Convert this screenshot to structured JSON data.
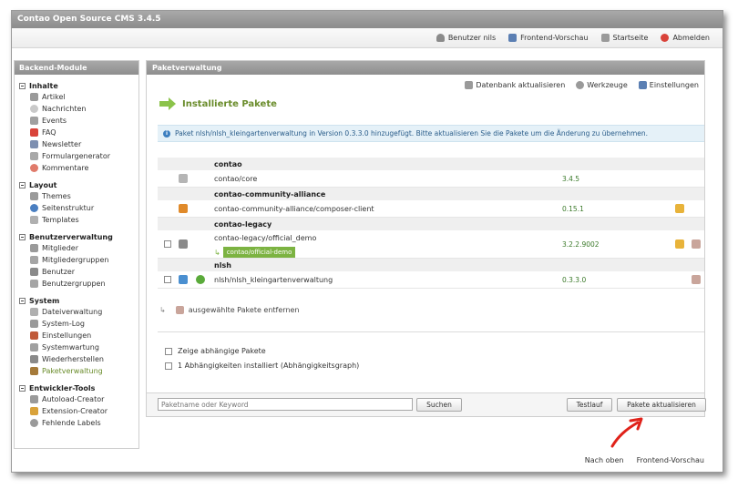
{
  "window": {
    "title": "Contao Open Source CMS 3.4.5"
  },
  "header": {
    "links": [
      {
        "label": "Benutzer nils",
        "icon": "user-icon"
      },
      {
        "label": "Frontend-Vorschau",
        "icon": "monitor-icon"
      },
      {
        "label": "Startseite",
        "icon": "home-icon"
      },
      {
        "label": "Abmelden",
        "icon": "logout-icon"
      }
    ]
  },
  "sidebar": {
    "title": "Backend-Module",
    "groups": [
      {
        "title": "Inhalte",
        "items": [
          "Artikel",
          "Nachrichten",
          "Events",
          "FAQ",
          "Newsletter",
          "Formulargenerator",
          "Kommentare"
        ]
      },
      {
        "title": "Layout",
        "items": [
          "Themes",
          "Seitenstruktur",
          "Templates"
        ]
      },
      {
        "title": "Benutzerverwaltung",
        "items": [
          "Mitglieder",
          "Mitgliedergruppen",
          "Benutzer",
          "Benutzergruppen"
        ]
      },
      {
        "title": "System",
        "items": [
          "Dateiverwaltung",
          "System-Log",
          "Einstellungen",
          "Systemwartung",
          "Wiederherstellen",
          "Paketverwaltung"
        ]
      },
      {
        "title": "Entwickler-Tools",
        "items": [
          "Autoload-Creator",
          "Extension-Creator",
          "Fehlende Labels"
        ]
      }
    ]
  },
  "main": {
    "title": "Paketverwaltung",
    "toolbar": [
      "Datenbank aktualisieren",
      "Werkzeuge",
      "Einstellungen"
    ],
    "section_title": "Installierte Pakete",
    "info": "Paket nlsh/nlsh_kleingartenverwaltung in Version 0.3.3.0 hinzugefügt. Bitte aktualisieren Sie die Pakete um die Änderung zu übernehmen.",
    "vendors": [
      {
        "name": "contao",
        "packages": [
          {
            "name": "contao/core",
            "version": "3.4.5"
          }
        ]
      },
      {
        "name": "contao-community-alliance",
        "packages": [
          {
            "name": "contao-community-alliance/composer-client",
            "version": "0.15.1"
          }
        ]
      },
      {
        "name": "contao-legacy",
        "packages": [
          {
            "name": "contao-legacy/official_demo",
            "version": "3.2.2.9002",
            "replaces": "contao/official-demo"
          }
        ]
      },
      {
        "name": "nlsh",
        "packages": [
          {
            "name": "nlsh/nlsh_kleingartenverwaltung",
            "version": "0.3.3.0"
          }
        ]
      }
    ],
    "remove_label": "ausgewählte Pakete entfernen",
    "options": [
      "Zeige abhängige Pakete",
      "1 Abhängigkeiten installiert (Abhängigkeitsgraph)"
    ],
    "search_placeholder": "Paketname oder Keyword",
    "search_button": "Suchen",
    "test_button": "Testlauf",
    "update_button": "Pakete aktualisieren"
  },
  "bottom_links": [
    "Nach oben",
    "Frontend-Vorschau"
  ],
  "colors": {
    "accent_green": "#6a8c2b",
    "header_gray": "#9a9a9a",
    "info_blue": "#e5f1f8"
  }
}
